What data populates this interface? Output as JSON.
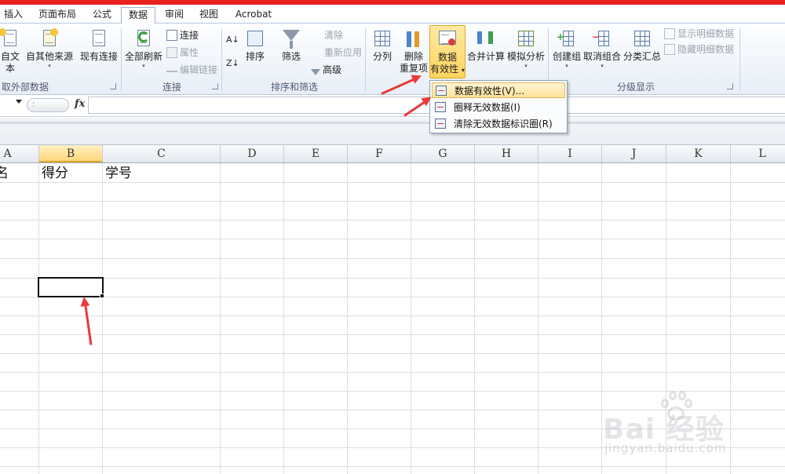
{
  "tabs": [
    {
      "label": "插入"
    },
    {
      "label": "页面布局"
    },
    {
      "label": "公式"
    },
    {
      "label": "数据",
      "active": true
    },
    {
      "label": "审阅"
    },
    {
      "label": "视图"
    },
    {
      "label": "Acrobat"
    }
  ],
  "ribbon": {
    "get_external": {
      "from_text": "自文本",
      "from_other": "自其他来源",
      "existing": "现有连接",
      "label": "取外部数据"
    },
    "connections": {
      "refresh_all": "全部刷新",
      "connections": "连接",
      "properties": "属性",
      "edit_links": "编辑链接",
      "label": "连接"
    },
    "sort_filter": {
      "sort": "排序",
      "filter": "筛选",
      "clear": "清除",
      "reapply": "重新应用",
      "advanced": "高级",
      "label": "排序和筛选"
    },
    "data_tools": {
      "text_to_columns": "分列",
      "remove_dup_1": "删除",
      "remove_dup_2": "重复项",
      "validation_1": "数据",
      "validation_2": "有效性",
      "consolidate": "合并计算",
      "what_if": "模拟分析"
    },
    "outline": {
      "group": "创建组",
      "ungroup": "取消组合",
      "subtotal": "分类汇总",
      "show_detail": "显示明细数据",
      "hide_detail": "隐藏明细数据",
      "label": "分级显示"
    }
  },
  "formula_bar": {
    "fx": "fx",
    "value": ""
  },
  "validation_menu": {
    "items": [
      {
        "label": "数据有效性(V)..."
      },
      {
        "label": "圈释无效数据(I)"
      },
      {
        "label": "清除无效数据标识圈(R)"
      }
    ]
  },
  "sheet": {
    "columns": [
      "A",
      "B",
      "C",
      "D",
      "E",
      "F",
      "G",
      "H",
      "I",
      "J",
      "K",
      "L"
    ],
    "selected_column": "B",
    "row1": {
      "a": "名",
      "b": "得分",
      "c": "学号"
    }
  },
  "watermark": {
    "brand": "Bai 经验",
    "url": "jingyan.baidu.com"
  },
  "colors": {
    "accent_red": "#e8201e",
    "highlight": "#ffd45c"
  }
}
